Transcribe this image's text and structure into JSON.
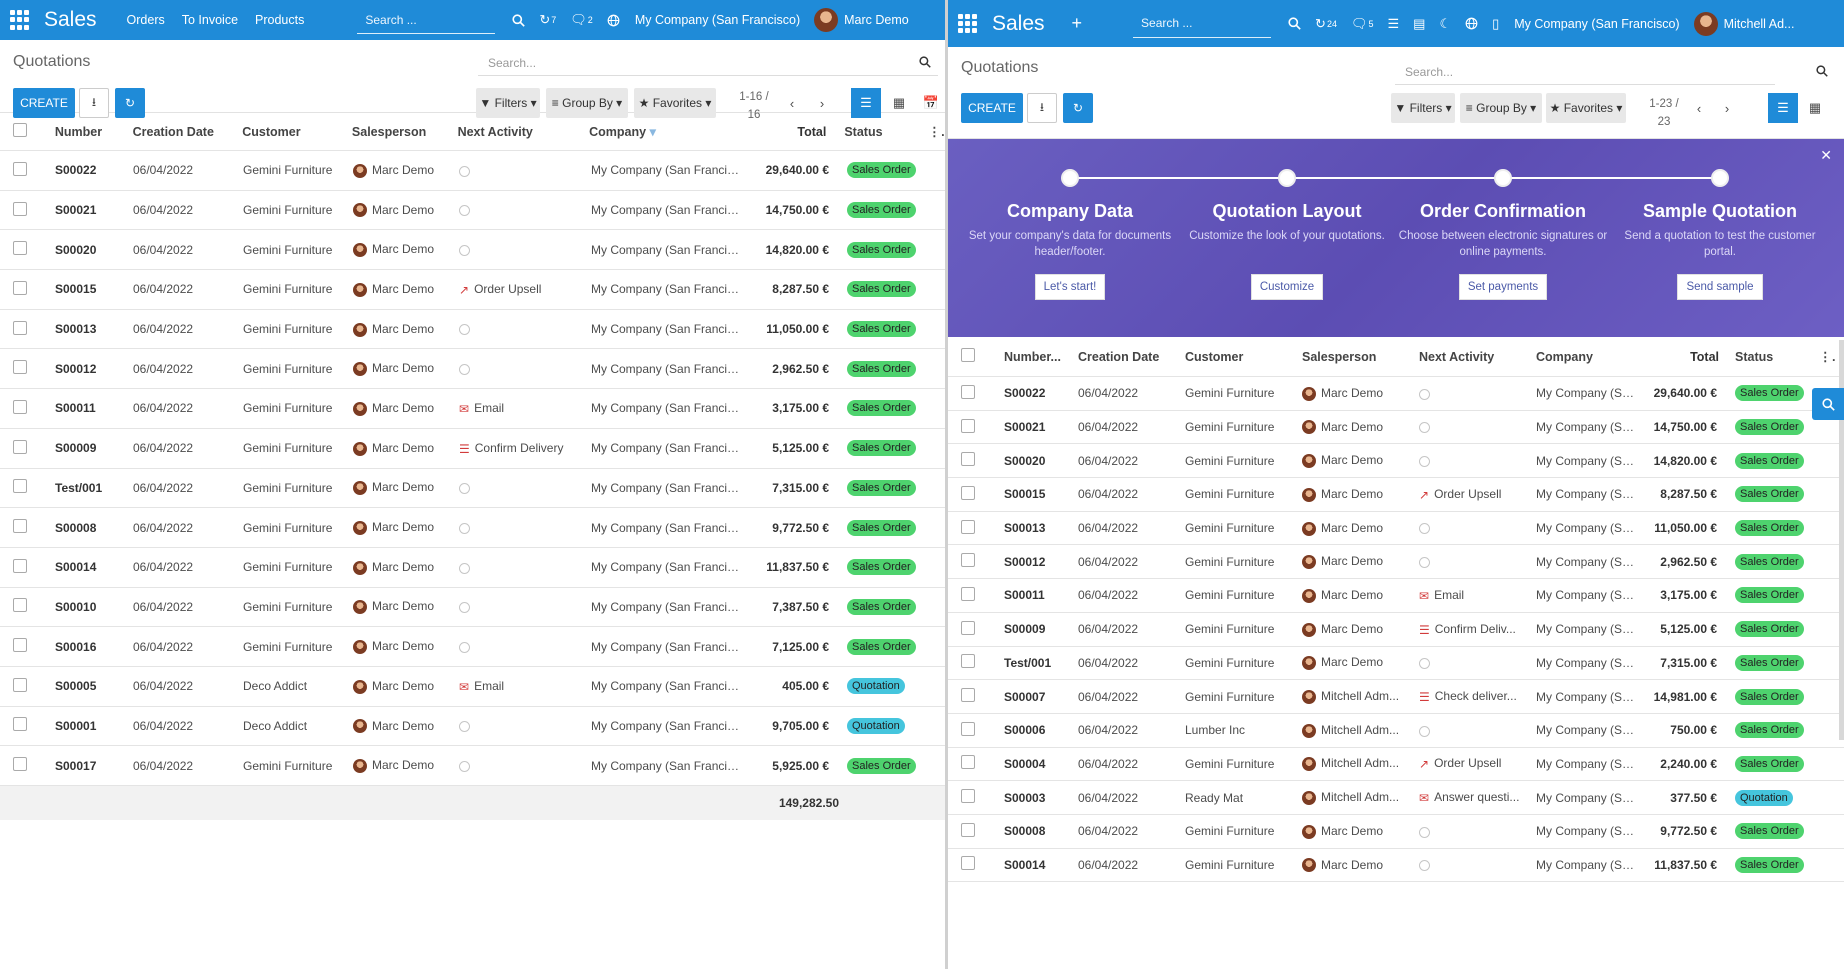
{
  "left": {
    "brand": "Sales",
    "menu": [
      "Orders",
      "To Invoice",
      "Products"
    ],
    "search_placeholder": "Search ...",
    "activities_count": "7",
    "messages_count": "2",
    "company": "My Company (San Francisco)",
    "user": "Marc Demo",
    "title": "Quotations",
    "list_search": "Search...",
    "create_label": "CREATE",
    "filters_label": "Filters",
    "groupby_label": "Group By",
    "favorites_label": "Favorites",
    "pager": "1-16 / 16",
    "columns": [
      "Number",
      "Creation Date",
      "Customer",
      "Salesperson",
      "Next Activity",
      "Company",
      "Total",
      "Status"
    ],
    "rows": [
      {
        "number": "S00022",
        "date": "06/04/2022",
        "customer": "Gemini Furniture",
        "sales": "Marc Demo",
        "activity": "",
        "icon": "",
        "company": "My Company (San Francisco)",
        "total": "29,640.00 €",
        "status": "Sales Order"
      },
      {
        "number": "S00021",
        "date": "06/04/2022",
        "customer": "Gemini Furniture",
        "sales": "Marc Demo",
        "activity": "",
        "icon": "",
        "company": "My Company (San Francisco)",
        "total": "14,750.00 €",
        "status": "Sales Order"
      },
      {
        "number": "S00020",
        "date": "06/04/2022",
        "customer": "Gemini Furniture",
        "sales": "Marc Demo",
        "activity": "",
        "icon": "",
        "company": "My Company (San Francisco)",
        "total": "14,820.00 €",
        "status": "Sales Order"
      },
      {
        "number": "S00015",
        "date": "06/04/2022",
        "customer": "Gemini Furniture",
        "sales": "Marc Demo",
        "activity": "Order Upsell",
        "icon": "chart",
        "company": "My Company (San Francisco)",
        "total": "8,287.50 €",
        "status": "Sales Order"
      },
      {
        "number": "S00013",
        "date": "06/04/2022",
        "customer": "Gemini Furniture",
        "sales": "Marc Demo",
        "activity": "",
        "icon": "",
        "company": "My Company (San Francisco)",
        "total": "11,050.00 €",
        "status": "Sales Order"
      },
      {
        "number": "S00012",
        "date": "06/04/2022",
        "customer": "Gemini Furniture",
        "sales": "Marc Demo",
        "activity": "",
        "icon": "",
        "company": "My Company (San Francisco)",
        "total": "2,962.50 €",
        "status": "Sales Order"
      },
      {
        "number": "S00011",
        "date": "06/04/2022",
        "customer": "Gemini Furniture",
        "sales": "Marc Demo",
        "activity": "Email",
        "icon": "mail",
        "company": "My Company (San Francisco)",
        "total": "3,175.00 €",
        "status": "Sales Order"
      },
      {
        "number": "S00009",
        "date": "06/04/2022",
        "customer": "Gemini Furniture",
        "sales": "Marc Demo",
        "activity": "Confirm Delivery",
        "icon": "list",
        "company": "My Company (San Francisco)",
        "total": "5,125.00 €",
        "status": "Sales Order"
      },
      {
        "number": "Test/001",
        "date": "06/04/2022",
        "customer": "Gemini Furniture",
        "sales": "Marc Demo",
        "activity": "",
        "icon": "",
        "company": "My Company (San Francisco)",
        "total": "7,315.00 €",
        "status": "Sales Order"
      },
      {
        "number": "S00008",
        "date": "06/04/2022",
        "customer": "Gemini Furniture",
        "sales": "Marc Demo",
        "activity": "",
        "icon": "",
        "company": "My Company (San Francisco)",
        "total": "9,772.50 €",
        "status": "Sales Order"
      },
      {
        "number": "S00014",
        "date": "06/04/2022",
        "customer": "Gemini Furniture",
        "sales": "Marc Demo",
        "activity": "",
        "icon": "",
        "company": "My Company (San Francisco)",
        "total": "11,837.50 €",
        "status": "Sales Order"
      },
      {
        "number": "S00010",
        "date": "06/04/2022",
        "customer": "Gemini Furniture",
        "sales": "Marc Demo",
        "activity": "",
        "icon": "",
        "company": "My Company (San Francisco)",
        "total": "7,387.50 €",
        "status": "Sales Order"
      },
      {
        "number": "S00016",
        "date": "06/04/2022",
        "customer": "Gemini Furniture",
        "sales": "Marc Demo",
        "activity": "",
        "icon": "",
        "company": "My Company (San Francisco)",
        "total": "7,125.00 €",
        "status": "Sales Order"
      },
      {
        "number": "S00005",
        "date": "06/04/2022",
        "customer": "Deco Addict",
        "sales": "Marc Demo",
        "activity": "Email",
        "icon": "mail",
        "company": "My Company (San Francisco)",
        "total": "405.00 €",
        "status": "Quotation"
      },
      {
        "number": "S00001",
        "date": "06/04/2022",
        "customer": "Deco Addict",
        "sales": "Marc Demo",
        "activity": "",
        "icon": "",
        "company": "My Company (San Francisco)",
        "total": "9,705.00 €",
        "status": "Quotation"
      },
      {
        "number": "S00017",
        "date": "06/04/2022",
        "customer": "Gemini Furniture",
        "sales": "Marc Demo",
        "activity": "",
        "icon": "",
        "company": "My Company (San Francisco)",
        "total": "5,925.00 €",
        "status": "Sales Order"
      }
    ],
    "sum_total": "149,282.50"
  },
  "right": {
    "brand": "Sales",
    "search_placeholder": "Search ...",
    "activities_count": "24",
    "messages_count": "5",
    "company": "My Company (San Francisco)",
    "user": "Mitchell Ad...",
    "title": "Quotations",
    "list_search": "Search...",
    "create_label": "CREATE",
    "filters_label": "Filters",
    "groupby_label": "Group By",
    "favorites_label": "Favorites",
    "pager": "1-23 / 23",
    "steps": [
      {
        "title": "Company Data",
        "desc": "Set your company's data for documents header/footer.",
        "button": "Let's start!"
      },
      {
        "title": "Quotation Layout",
        "desc": "Customize the look of your quotations.",
        "button": "Customize"
      },
      {
        "title": "Order Confirmation",
        "desc": "Choose between electronic signatures or online payments.",
        "button": "Set payments"
      },
      {
        "title": "Sample Quotation",
        "desc": "Send a quotation to test the customer portal.",
        "button": "Send sample"
      }
    ],
    "columns": [
      "Number...",
      "Creation Date",
      "Customer",
      "Salesperson",
      "Next Activity",
      "Company",
      "Total",
      "Status"
    ],
    "rows": [
      {
        "number": "S00022",
        "date": "06/04/2022",
        "customer": "Gemini Furniture",
        "sales": "Marc Demo",
        "activity": "",
        "icon": "",
        "company": "My Company (Sa...",
        "total": "29,640.00 €",
        "status": "Sales Order"
      },
      {
        "number": "S00021",
        "date": "06/04/2022",
        "customer": "Gemini Furniture",
        "sales": "Marc Demo",
        "activity": "",
        "icon": "",
        "company": "My Company (Sa...",
        "total": "14,750.00 €",
        "status": "Sales Order"
      },
      {
        "number": "S00020",
        "date": "06/04/2022",
        "customer": "Gemini Furniture",
        "sales": "Marc Demo",
        "activity": "",
        "icon": "",
        "company": "My Company (Sa...",
        "total": "14,820.00 €",
        "status": "Sales Order"
      },
      {
        "number": "S00015",
        "date": "06/04/2022",
        "customer": "Gemini Furniture",
        "sales": "Marc Demo",
        "activity": "Order Upsell",
        "icon": "chart",
        "company": "My Company (Sa...",
        "total": "8,287.50 €",
        "status": "Sales Order"
      },
      {
        "number": "S00013",
        "date": "06/04/2022",
        "customer": "Gemini Furniture",
        "sales": "Marc Demo",
        "activity": "",
        "icon": "",
        "company": "My Company (Sa...",
        "total": "11,050.00 €",
        "status": "Sales Order"
      },
      {
        "number": "S00012",
        "date": "06/04/2022",
        "customer": "Gemini Furniture",
        "sales": "Marc Demo",
        "activity": "",
        "icon": "",
        "company": "My Company (Sa...",
        "total": "2,962.50 €",
        "status": "Sales Order"
      },
      {
        "number": "S00011",
        "date": "06/04/2022",
        "customer": "Gemini Furniture",
        "sales": "Marc Demo",
        "activity": "Email",
        "icon": "mail",
        "company": "My Company (Sa...",
        "total": "3,175.00 €",
        "status": "Sales Order"
      },
      {
        "number": "S00009",
        "date": "06/04/2022",
        "customer": "Gemini Furniture",
        "sales": "Marc Demo",
        "activity": "Confirm Deliv...",
        "icon": "list",
        "company": "My Company (Sa...",
        "total": "5,125.00 €",
        "status": "Sales Order"
      },
      {
        "number": "Test/001",
        "date": "06/04/2022",
        "customer": "Gemini Furniture",
        "sales": "Marc Demo",
        "activity": "",
        "icon": "",
        "company": "My Company (Sa...",
        "total": "7,315.00 €",
        "status": "Sales Order"
      },
      {
        "number": "S00007",
        "date": "06/04/2022",
        "customer": "Gemini Furniture",
        "sales": "Mitchell Adm...",
        "activity": "Check deliver...",
        "icon": "list",
        "company": "My Company (Sa...",
        "total": "14,981.00 €",
        "status": "Sales Order"
      },
      {
        "number": "S00006",
        "date": "06/04/2022",
        "customer": "Lumber Inc",
        "sales": "Mitchell Adm...",
        "activity": "",
        "icon": "",
        "company": "My Company (Sa...",
        "total": "750.00 €",
        "status": "Sales Order"
      },
      {
        "number": "S00004",
        "date": "06/04/2022",
        "customer": "Gemini Furniture",
        "sales": "Mitchell Adm...",
        "activity": "Order Upsell",
        "icon": "chart",
        "company": "My Company (Sa...",
        "total": "2,240.00 €",
        "status": "Sales Order"
      },
      {
        "number": "S00003",
        "date": "06/04/2022",
        "customer": "Ready Mat",
        "sales": "Mitchell Adm...",
        "activity": "Answer questi...",
        "icon": "mail",
        "company": "My Company (Sa...",
        "total": "377.50 €",
        "status": "Quotation"
      },
      {
        "number": "S00008",
        "date": "06/04/2022",
        "customer": "Gemini Furniture",
        "sales": "Marc Demo",
        "activity": "",
        "icon": "",
        "company": "My Company (Sa...",
        "total": "9,772.50 €",
        "status": "Sales Order"
      },
      {
        "number": "S00014",
        "date": "06/04/2022",
        "customer": "Gemini Furniture",
        "sales": "Marc Demo",
        "activity": "",
        "icon": "",
        "company": "My Company (Sa...",
        "total": "11,837.50 €",
        "status": "Sales Order"
      }
    ]
  },
  "colors": {
    "navbar": "#1f8bd8",
    "banner": "#5c4db3",
    "sales_order": "#4ed36e",
    "quotation": "#45c5dd",
    "activity_red": "#d23b3b"
  }
}
